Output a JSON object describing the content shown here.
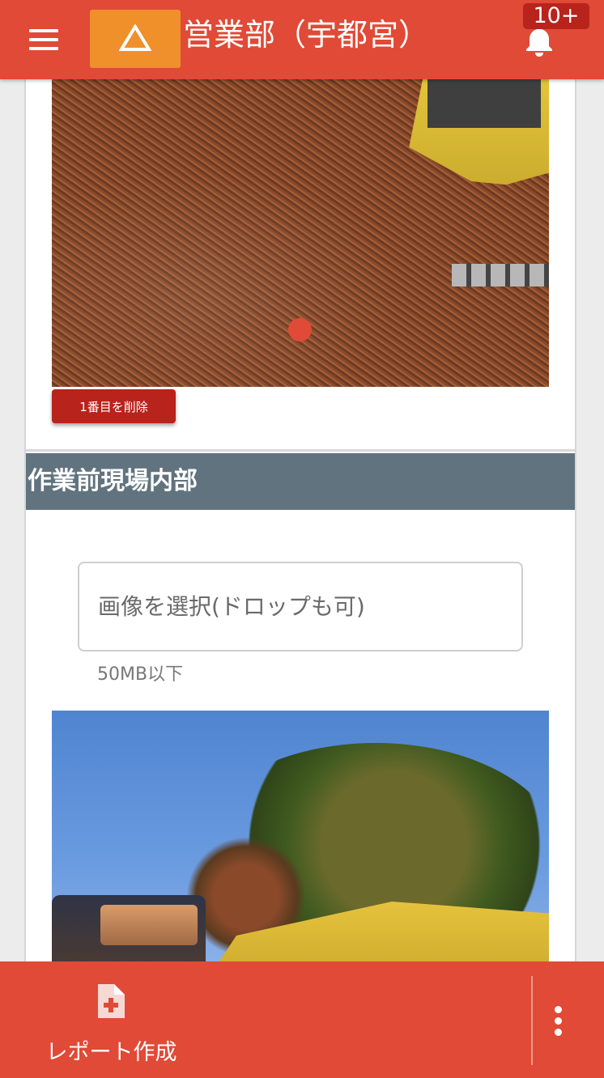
{
  "header": {
    "title": "営業部（宇都宮）",
    "notification_badge": "10+",
    "menu_icon": "hamburger-menu-icon",
    "logo_icon": "triangle-logo-icon",
    "bell_icon": "bell-icon",
    "bar_color": "#e04a36",
    "logo_color": "#f0902a"
  },
  "first_image": {
    "delete_button_label": "1番目を削除"
  },
  "section": {
    "title": "作業前現場内部",
    "header_color": "#60737f",
    "file_input_placeholder": "画像を選択(ドロップも可)",
    "file_size_hint": "50MB以下"
  },
  "bottom_bar": {
    "report_label": "レポート作成",
    "report_icon": "add-document-icon",
    "more_icon": "more-vertical-icon"
  }
}
